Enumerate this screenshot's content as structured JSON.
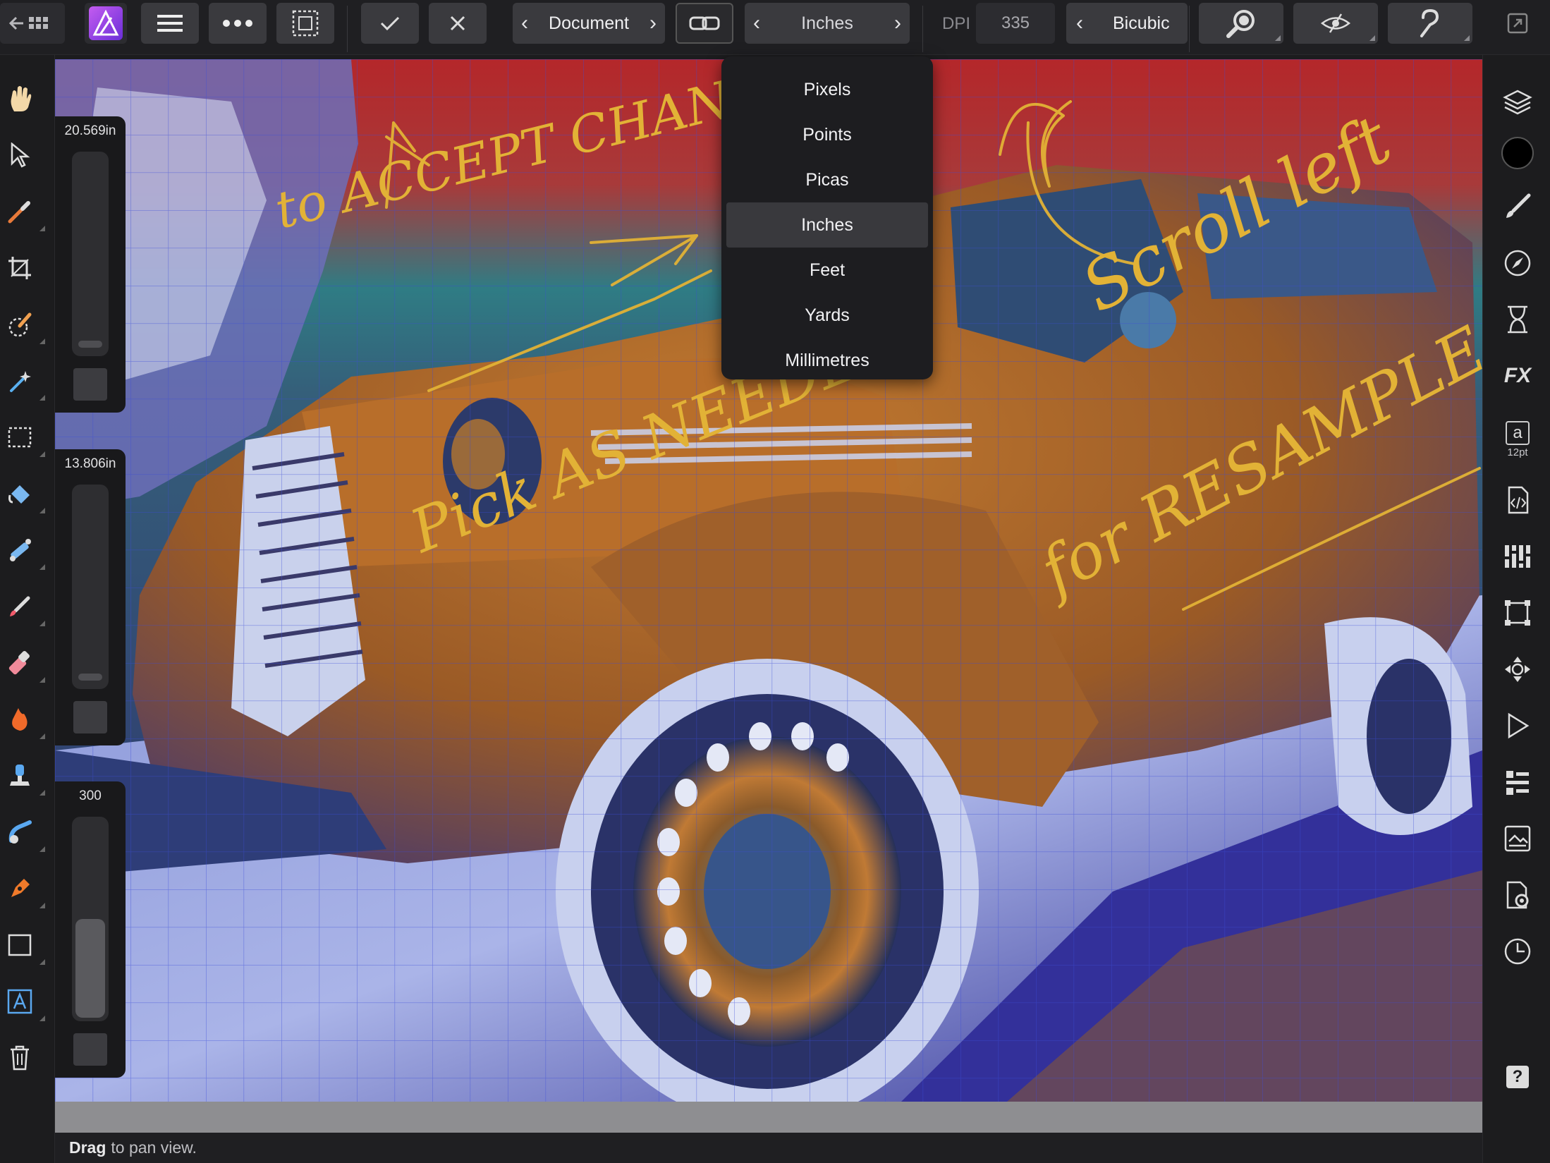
{
  "toolbar": {
    "document_label": "Document",
    "units_label": "Inches",
    "dpi_label": "DPI",
    "dpi_value": "335",
    "resample_label": "Bicubic",
    "icons": [
      "back-icon",
      "grid-icon",
      "app-logo-icon",
      "menu-icon",
      "more-icon",
      "selection-icon",
      "checkmark-icon",
      "close-icon",
      "link-icon",
      "zoom-icon",
      "view-icon",
      "help-icon",
      "expand-icon"
    ]
  },
  "unit_menu": {
    "options": [
      "Pixels",
      "Points",
      "Picas",
      "Inches",
      "Feet",
      "Yards",
      "Millimetres"
    ],
    "selected_index": 3
  },
  "sliders": [
    {
      "value": "20.569in",
      "level": 0.03
    },
    {
      "value": "13.806in",
      "level": 0.03
    },
    {
      "value": "300",
      "level": 0.5
    }
  ],
  "left_tools": [
    "hand-icon",
    "pointer-icon",
    "color-picker-icon",
    "crop-icon",
    "selection-brush-icon",
    "magic-wand-icon",
    "marquee-icon",
    "flood-fill-icon",
    "gradient-icon",
    "paint-brush-icon",
    "eraser-icon",
    "burn-icon",
    "clone-icon",
    "smudge-icon",
    "pen-icon",
    "rectangle-icon",
    "text-icon",
    "delete-icon"
  ],
  "right_tools": {
    "icons": [
      "layers-icon",
      "color-icon",
      "brushes-icon",
      "navigator-icon",
      "history-icon",
      "fx-icon",
      "text-styles-icon",
      "code-icon",
      "channels-icon",
      "transform-icon",
      "move-icon",
      "play-icon",
      "styles-icon",
      "library-icon",
      "settings-icon",
      "clock-icon",
      "question-icon"
    ],
    "text_size": "12pt",
    "text_icon_glyph": "a",
    "fx_glyph": "FX",
    "help_glyph": "?"
  },
  "annotations": [
    "to ACCEPT CHANGES",
    "Pick AS NEEDED",
    "Scroll left",
    "for RESAMPLE"
  ],
  "status": {
    "bold": "Drag",
    "rest": "to pan view."
  }
}
